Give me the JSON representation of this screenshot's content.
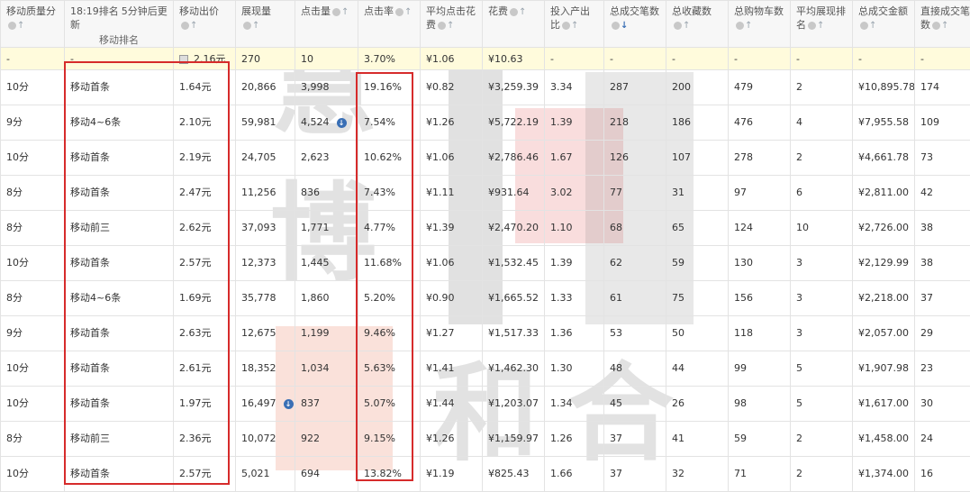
{
  "watermark": {
    "chars": [
      "慧",
      "博",
      "和",
      "合"
    ]
  },
  "headers": [
    {
      "label": "移动质量分",
      "dot": true,
      "arrow": "↑",
      "active": false
    },
    {
      "label": "18:19排名",
      "tail": "5分钟后更新",
      "sub": "移动排名",
      "dot": false,
      "arrow": "",
      "active": false
    },
    {
      "label": "移动出价",
      "dot": true,
      "arrow": "↑",
      "active": false
    },
    {
      "label": "展现量",
      "dot": true,
      "arrow": "↑",
      "active": false
    },
    {
      "label": "点击量",
      "dot": true,
      "arrow": "↑",
      "active": false
    },
    {
      "label": "点击率",
      "dot": true,
      "arrow": "↑",
      "active": false
    },
    {
      "label": "平均点击花费",
      "dot": true,
      "arrow": "↑",
      "active": false
    },
    {
      "label": "花费",
      "dot": true,
      "arrow": "↑",
      "active": false
    },
    {
      "label": "投入产出比",
      "dot": true,
      "arrow": "↑",
      "active": false
    },
    {
      "label": "总成交笔数",
      "dot": true,
      "arrow": "↓",
      "active": true
    },
    {
      "label": "总收藏数",
      "dot": true,
      "arrow": "↑",
      "active": false
    },
    {
      "label": "总购物车数",
      "dot": true,
      "arrow": "↑",
      "active": false
    },
    {
      "label": "平均展现排名",
      "dot": true,
      "arrow": "↑",
      "active": false
    },
    {
      "label": "总成交金额",
      "dot": true,
      "arrow": "↑",
      "active": false
    },
    {
      "label": "直接成交笔数",
      "dot": true,
      "arrow": "↑",
      "active": false
    }
  ],
  "summary": [
    "-",
    "-",
    "2.16元",
    "270",
    "10",
    "3.70%",
    "¥1.06",
    "¥10.63",
    "-",
    "-",
    "-",
    "-",
    "-",
    "-",
    "-"
  ],
  "rows": [
    [
      "10分",
      "移动首条",
      "1.64元",
      "20,866",
      "3,998",
      "19.16%",
      "¥0.82",
      "¥3,259.39",
      "3.34",
      "287",
      "200",
      "479",
      "2",
      "¥10,895.78",
      "174"
    ],
    [
      "9分",
      "移动4~6条",
      "2.10元",
      "59,981",
      "4,524",
      "7.54%",
      "¥1.26",
      "¥5,722.19",
      "1.39",
      "218",
      "186",
      "476",
      "4",
      "¥7,955.58",
      "109"
    ],
    [
      "10分",
      "移动首条",
      "2.19元",
      "24,705",
      "2,623",
      "10.62%",
      "¥1.06",
      "¥2,786.46",
      "1.67",
      "126",
      "107",
      "278",
      "2",
      "¥4,661.78",
      "73"
    ],
    [
      "8分",
      "移动首条",
      "2.47元",
      "11,256",
      "836",
      "7.43%",
      "¥1.11",
      "¥931.64",
      "3.02",
      "77",
      "31",
      "97",
      "6",
      "¥2,811.00",
      "42"
    ],
    [
      "8分",
      "移动前三",
      "2.62元",
      "37,093",
      "1,771",
      "4.77%",
      "¥1.39",
      "¥2,470.20",
      "1.10",
      "68",
      "65",
      "124",
      "10",
      "¥2,726.00",
      "38"
    ],
    [
      "10分",
      "移动首条",
      "2.57元",
      "12,373",
      "1,445",
      "11.68%",
      "¥1.06",
      "¥1,532.45",
      "1.39",
      "62",
      "59",
      "130",
      "3",
      "¥2,129.99",
      "38"
    ],
    [
      "8分",
      "移动4~6条",
      "1.69元",
      "35,778",
      "1,860",
      "5.20%",
      "¥0.90",
      "¥1,665.52",
      "1.33",
      "61",
      "75",
      "156",
      "3",
      "¥2,218.00",
      "37"
    ],
    [
      "9分",
      "移动首条",
      "2.63元",
      "12,675",
      "1,199",
      "9.46%",
      "¥1.27",
      "¥1,517.33",
      "1.36",
      "53",
      "50",
      "118",
      "3",
      "¥2,057.00",
      "29"
    ],
    [
      "10分",
      "移动首条",
      "2.61元",
      "18,352",
      "1,034",
      "5.63%",
      "¥1.41",
      "¥1,462.30",
      "1.30",
      "48",
      "44",
      "99",
      "5",
      "¥1,907.98",
      "23"
    ],
    [
      "10分",
      "移动首条",
      "1.97元",
      "16,497",
      "837",
      "5.07%",
      "¥1.44",
      "¥1,203.07",
      "1.34",
      "45",
      "26",
      "98",
      "5",
      "¥1,617.00",
      "30"
    ],
    [
      "8分",
      "移动前三",
      "2.36元",
      "10,072",
      "922",
      "9.15%",
      "¥1.26",
      "¥1,159.97",
      "1.26",
      "37",
      "41",
      "59",
      "2",
      "¥1,458.00",
      "24"
    ],
    [
      "10分",
      "移动首条",
      "2.57元",
      "5,021",
      "694",
      "13.82%",
      "¥1.19",
      "¥825.43",
      "1.66",
      "37",
      "32",
      "71",
      "2",
      "¥1,374.00",
      "16"
    ]
  ],
  "info_cells": [
    [
      1,
      4
    ],
    [
      9,
      3
    ]
  ],
  "colors": {
    "highlight_box": "#d62b2b",
    "summary_bg": "#fffbdc",
    "active_sort": "#3a6fb5"
  }
}
